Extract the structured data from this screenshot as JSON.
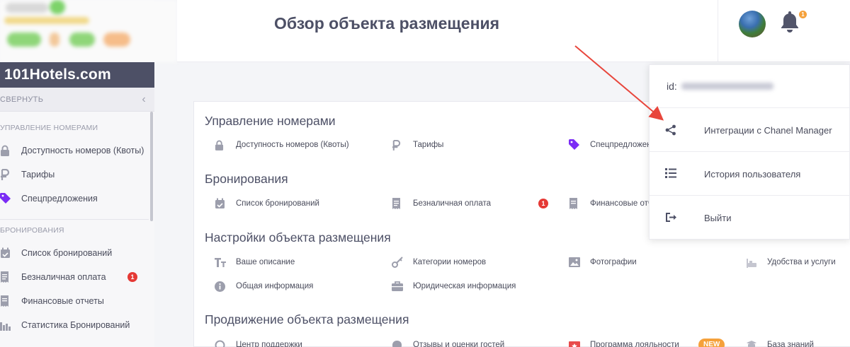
{
  "sidebar": {
    "brand": "101Hotels.com",
    "collapse_label": "СВЕРНУТЬ",
    "sections": [
      {
        "title": "УПРАВЛЕНИЕ НОМЕРАМИ",
        "items": [
          {
            "label": "Доступность номеров (Квоты)",
            "icon": "lock-icon"
          },
          {
            "label": "Тарифы",
            "icon": "ruble-icon"
          },
          {
            "label": "Спецпредложения",
            "icon": "tag-icon"
          }
        ]
      },
      {
        "title": "БРОНИРОВАНИЯ",
        "items": [
          {
            "label": "Список бронирований",
            "icon": "calendar-icon"
          },
          {
            "label": "Безналичная оплата",
            "icon": "receipt-icon",
            "badge": "1"
          },
          {
            "label": "Финансовые отчеты",
            "icon": "report-icon"
          },
          {
            "label": "Статистика Бронирований",
            "icon": "bar-chart-icon"
          }
        ]
      }
    ]
  },
  "header": {
    "title": "Обзор объекта размещения",
    "notification_count": "1"
  },
  "main": {
    "sections": [
      {
        "title": "Управление номерами",
        "items": [
          {
            "label": "Доступность номеров (Квоты)",
            "icon": "lock-icon"
          },
          {
            "label": "Тарифы",
            "icon": "ruble-icon"
          },
          {
            "label": "Спецпредложения",
            "icon": "tag-icon"
          }
        ]
      },
      {
        "title": "Бронирования",
        "items": [
          {
            "label": "Список бронирований",
            "icon": "calendar-icon"
          },
          {
            "label": "Безналичная оплата",
            "icon": "receipt-icon",
            "badge": "1"
          },
          {
            "label": "Финансовые отчеты",
            "icon": "report-icon"
          }
        ]
      },
      {
        "title": "Настройки объекта размещения",
        "items": [
          {
            "label": "Ваше описание",
            "icon": "text-icon"
          },
          {
            "label": "Категории номеров",
            "icon": "key-icon"
          },
          {
            "label": "Фотографии",
            "icon": "image-icon"
          },
          {
            "label": "Удобства и услуги",
            "icon": "amenities-icon"
          },
          {
            "label": "Общая информация",
            "icon": "info-icon"
          },
          {
            "label": "Юридическая информация",
            "icon": "briefcase-icon"
          }
        ]
      },
      {
        "title": "Продвижение объекта размещения",
        "items": [
          {
            "label": "Центр поддержки",
            "icon": "support-icon"
          },
          {
            "label": "Отзывы и оценки гостей",
            "icon": "review-icon"
          },
          {
            "label": "Программа лояльности",
            "icon": "loyalty-icon",
            "badge": "NEW"
          },
          {
            "label": "База знаний",
            "icon": "knowledge-icon"
          }
        ]
      }
    ]
  },
  "dropdown": {
    "id_label": "id:",
    "items": [
      {
        "label": "Интеграции с Chanel Manager",
        "icon": "share-icon"
      },
      {
        "label": "История пользователя",
        "icon": "list-icon"
      },
      {
        "label": "Выйти",
        "icon": "logout-icon"
      }
    ]
  },
  "colors": {
    "brand_bar": "#4d5066",
    "tag_purple": "#7b2cf5",
    "badge_red": "#e53935",
    "badge_orange": "#f5a13b",
    "arrow_red": "#e8463c"
  }
}
